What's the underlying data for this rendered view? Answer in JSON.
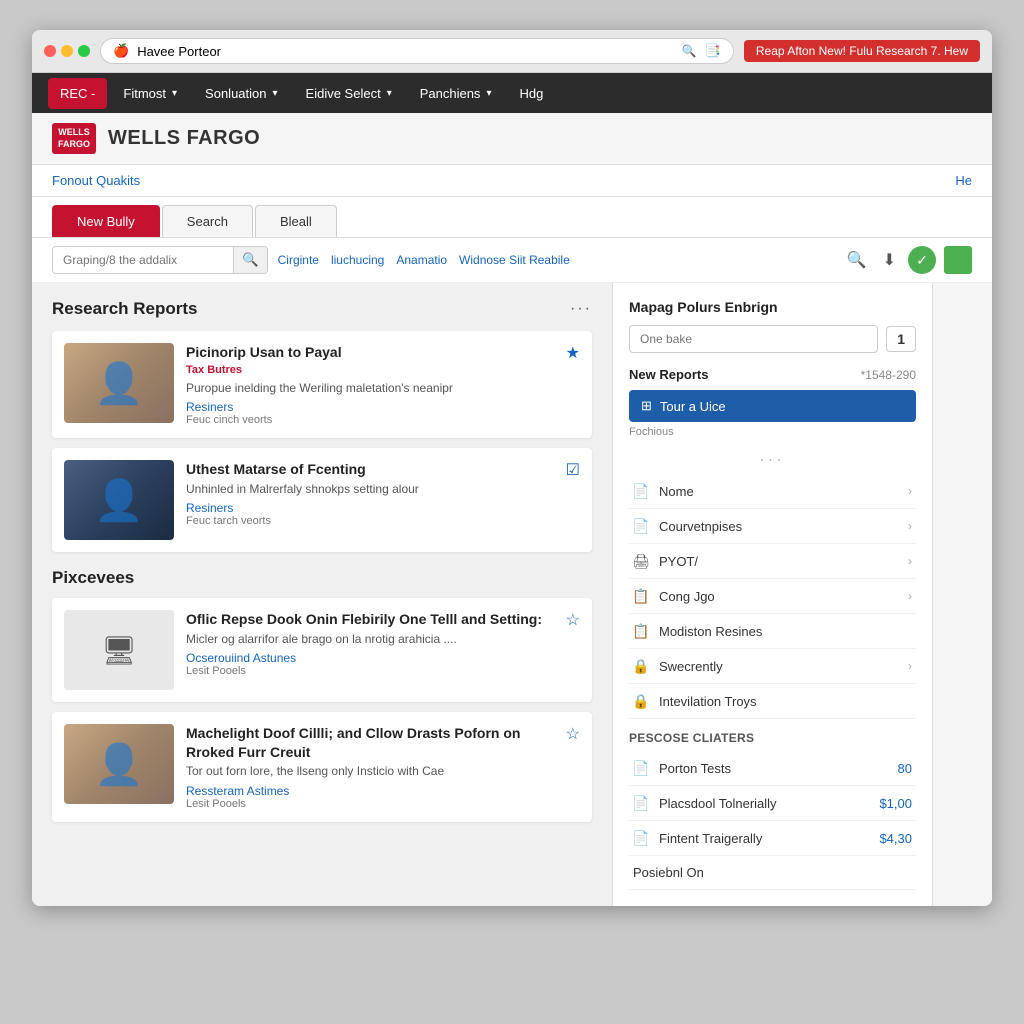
{
  "browser": {
    "address": "Havee Porteor",
    "notification": "Reap Afton New! Fulu Research 7. Hew"
  },
  "navbar": {
    "rec_label": "REC -",
    "items": [
      {
        "label": "Fitmost",
        "hasDropdown": true
      },
      {
        "label": "Sonluation",
        "hasDropdown": true
      },
      {
        "label": "Eidive Select",
        "hasDropdown": true
      },
      {
        "label": "Panchiens",
        "hasDropdown": true
      },
      {
        "label": "Hdg",
        "hasDropdown": false
      }
    ]
  },
  "wf_header": {
    "logo_line1": "WELLS",
    "logo_line2": "FARGO",
    "title": "WELLS FARGO"
  },
  "sub_nav": {
    "left_link": "Fonout Quakits",
    "right_link": "He"
  },
  "tabs": [
    {
      "label": "New Bully",
      "active": true
    },
    {
      "label": "Search",
      "active": false
    },
    {
      "label": "Bleall",
      "active": false
    }
  ],
  "toolbar": {
    "search_placeholder": "Graping/8 the addalix",
    "links": [
      {
        "label": "Cirginte"
      },
      {
        "label": "liuchucing"
      },
      {
        "label": "Anamatio"
      },
      {
        "label": "Widnose Siit Reabile"
      }
    ]
  },
  "research_reports": {
    "title": "Research Reports",
    "articles": [
      {
        "title": "Picinorip Usan to Payal",
        "category": "Tax Butres",
        "desc": "Puropue inelding the Weriling maletation's neanipr",
        "author": "Resiners",
        "date": "Feuc cinch veorts",
        "starred": true
      },
      {
        "title": "Uthest Matarse of Fcenting",
        "category": "",
        "desc": "Unhinled in Malrerfaly shnokps setting alour",
        "author": "Resiners",
        "date": "Feuc tarch veorts",
        "starred": true
      }
    ]
  },
  "pixcevees": {
    "title": "Pixcevees",
    "articles": [
      {
        "title": "Oflic Repse Dook Onin Flebirily One Telll and Setting:",
        "category": "",
        "desc": "Micler og alarrifor ale brago on la nrotig arahicia ....",
        "author": "Ocserouiind Astunes",
        "date": "Lesit Pooels",
        "starred": true
      },
      {
        "title": "Machelight Doof Cillli; and Cllow Drasts Poforn on Rroked Furr Creuit",
        "category": "",
        "desc": "Tor out forn lore, the llseng only Insticio with Cae",
        "author": "Ressteram Astimes",
        "date": "Lesit Pooels",
        "starred": true
      }
    ]
  },
  "right_panel": {
    "title": "Mapag Polurs Enbrign",
    "search_placeholder": "One bake",
    "badge": "1",
    "new_reports_label": "New Reports",
    "new_reports_num": "*1548-290",
    "tour_btn": "Tour a Uice",
    "fochious": "Fochious",
    "dots": "...",
    "menu_items": [
      {
        "icon": "📄",
        "label": "Nome",
        "has_chevron": true
      },
      {
        "icon": "📄",
        "label": "Courvetnpises",
        "has_chevron": true
      },
      {
        "icon": "🖨",
        "label": "PYOT/",
        "has_chevron": true
      },
      {
        "icon": "📋",
        "label": "Cong Jgo",
        "has_chevron": true
      },
      {
        "icon": "📋",
        "label": "Modiston Resines",
        "has_chevron": false
      },
      {
        "icon": "🔒",
        "label": "Swecrently",
        "has_chevron": true
      },
      {
        "icon": "🔒",
        "label": "Intevilation Troys",
        "has_chevron": false
      }
    ],
    "pescose_label": "Pescose Cliaters",
    "pescose_items": [
      {
        "icon": "📄",
        "label": "Porton Tests",
        "value": "80",
        "value_color": "blue"
      },
      {
        "icon": "📄",
        "label": "Placsdool Tolnerially",
        "value": "$1,00",
        "value_color": "blue"
      },
      {
        "icon": "📄",
        "label": "Fintent Traigerally",
        "value": "$4,30",
        "value_color": "blue"
      }
    ],
    "bottom_label": "Posiebnl On"
  }
}
